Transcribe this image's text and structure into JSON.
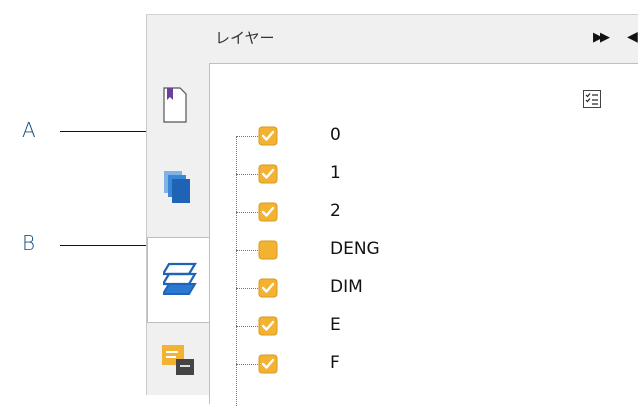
{
  "callouts": [
    {
      "label": "A"
    },
    {
      "label": "B"
    }
  ],
  "panel": {
    "title": "レイヤー",
    "tabs": [
      {
        "icon": "page-bookmark-icon",
        "active": false
      },
      {
        "icon": "pages-icon",
        "active": false
      },
      {
        "icon": "layers-icon",
        "active": true
      },
      {
        "icon": "comments-icon",
        "active": false
      }
    ],
    "options_icon": "layer-options-icon"
  },
  "layers": [
    {
      "name": "0",
      "checked": true
    },
    {
      "name": "1",
      "checked": true
    },
    {
      "name": "2",
      "checked": true
    },
    {
      "name": "DENG",
      "checked": false
    },
    {
      "name": "DIM",
      "checked": true
    },
    {
      "name": "E",
      "checked": true
    },
    {
      "name": "F",
      "checked": true
    }
  ],
  "colors": {
    "checkbox": "#f4b233",
    "check": "#ffffff",
    "accent": "#2a6fc9"
  }
}
